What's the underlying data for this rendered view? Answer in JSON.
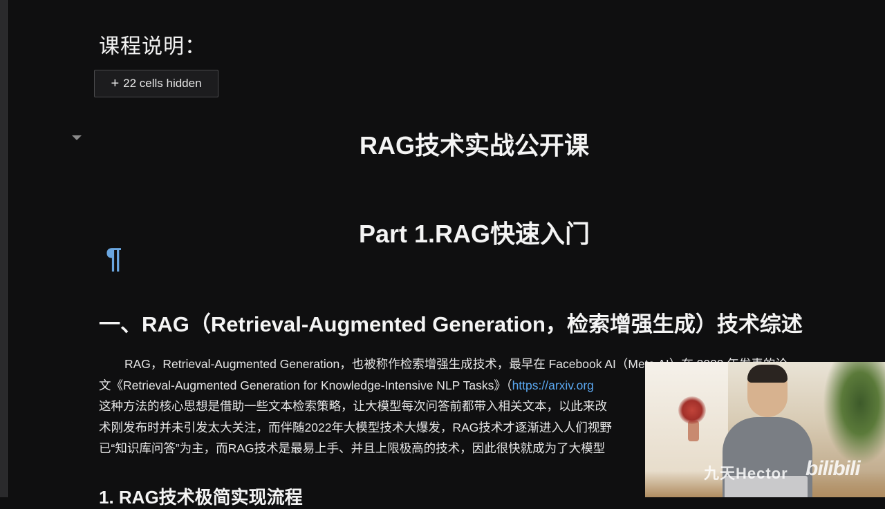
{
  "notebook": {
    "course_note": "课程说明：",
    "hidden_cells_label": "22 cells hidden",
    "title": "RAG技术实战公开课",
    "part_title": "Part 1.RAG快速入门",
    "pilcrow": "¶",
    "section_heading": "一、RAG（Retrieval-Augmented Generation，检索增强生成）技术综述",
    "paragraph": {
      "line1": "RAG，Retrieval-Augmented Generation，也被称作检索增强生成技术，最早在 Facebook AI（Meta AI）在 2020 年发表的论",
      "line2_prefix": "文《Retrieval-Augmented Generation for Knowledge-Intensive NLP Tasks》（",
      "line2_link": "https://arxiv.org",
      "line3": "这种方法的核心思想是借助一些文本检索策略，让大模型每次问答前都带入相关文本，以此来改",
      "line4": "术刚发布时并未引发太大关注，而伴随2022年大模型技术大爆发，RAG技术才逐渐进入人们视野",
      "line5": "已“知识库问答”为主，而RAG技术是最易上手、并且上限极高的技术，因此很快就成为了大模型"
    },
    "sub_heading": "1. RAG技术极简实现流程"
  },
  "webcam": {
    "watermark_name": "九天Hector",
    "watermark_logo": "bilibili"
  },
  "colors": {
    "background": "#0f0f10",
    "link": "#5aa7f0",
    "pilcrow": "#6aa6e0"
  }
}
